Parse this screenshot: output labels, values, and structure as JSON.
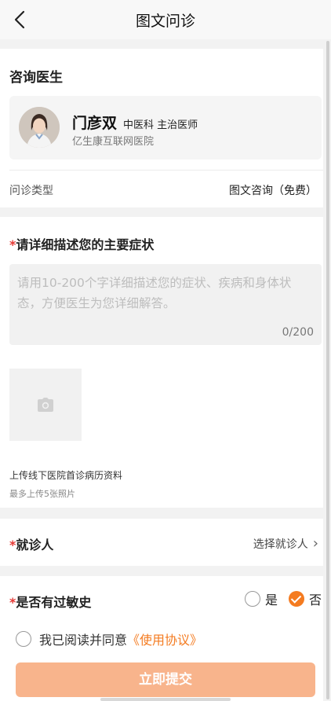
{
  "header": {
    "title": "图文问诊",
    "back_icon": "chevron-left-icon"
  },
  "consult_doctor": {
    "section_title": "咨询医生",
    "doctor": {
      "name": "门彦双",
      "title": "中医科 主治医师",
      "hospital": "亿生康互联网医院"
    },
    "type_label": "问诊类型",
    "type_value": "图文咨询（免费）"
  },
  "symptoms": {
    "required_mark": "*",
    "title": "请详细描述您的主要症状",
    "placeholder": "请用10-200个字详细描述您的症状、疾病和身体状态，方便医生为您详细解答。",
    "value": "",
    "counter": "0/200",
    "upload_icon": "camera-icon",
    "upload_title": "上传线下医院首诊病历资料",
    "upload_hint": "最多上传5张照片"
  },
  "patient": {
    "required_mark": "*",
    "label": "就诊人",
    "action": "选择就诊人",
    "chevron": "›"
  },
  "allergy": {
    "required_mark": "*",
    "label": "是否有过敏史",
    "options": [
      {
        "label": "是",
        "selected": false
      },
      {
        "label": "否",
        "selected": true
      }
    ]
  },
  "agreement": {
    "text": "我已阅读并同意",
    "link": "《使用协议》",
    "checked": false
  },
  "submit_label": "立即提交",
  "colors": {
    "accent": "#f47b20",
    "submit_bg": "#f8b48c",
    "required": "#e53935"
  }
}
